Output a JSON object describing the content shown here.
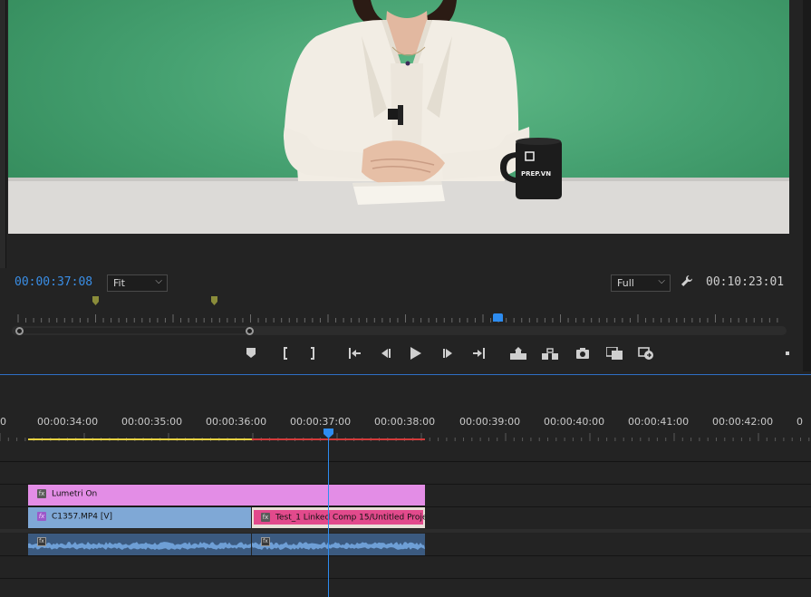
{
  "monitor": {
    "current_timecode": "00:00:37:08",
    "duration_timecode": "00:10:23:01",
    "zoom_select": "Fit",
    "resolution_select": "Full",
    "mug_logo_text": "PREP.VN"
  },
  "controls": {
    "icons": [
      "add-marker-icon",
      "mark-in-icon",
      "mark-out-icon",
      "go-to-in-icon",
      "step-back-icon",
      "play-icon",
      "step-forward-icon",
      "go-to-out-icon",
      "lift-icon",
      "extract-icon",
      "export-frame-icon",
      "comparison-view-icon",
      "toggle-proxies-icon"
    ]
  },
  "timeline": {
    "ruler_labels": [
      "0",
      "00:00:34:00",
      "00:00:35:00",
      "00:00:36:00",
      "00:00:37:00",
      "00:00:38:00",
      "00:00:39:00",
      "00:00:40:00",
      "00:00:41:00",
      "00:00:42:00",
      "0"
    ],
    "clips": {
      "lumetri": "Lumetri On",
      "c1357": "C1357.MP4 [V]",
      "test": "Test_1 Linked Comp 15/Untitled Proje"
    }
  },
  "colors": {
    "accent_blue": "#2d8cf0",
    "adjustment_clip": "#e38de6",
    "video_clip": "#7fa8d6",
    "linked_comp_clip": "#e24a8c",
    "audio_clip": "#3b5a80",
    "workarea_rendered": "#e6d040",
    "workarea_unrendered": "#d23a3a"
  }
}
